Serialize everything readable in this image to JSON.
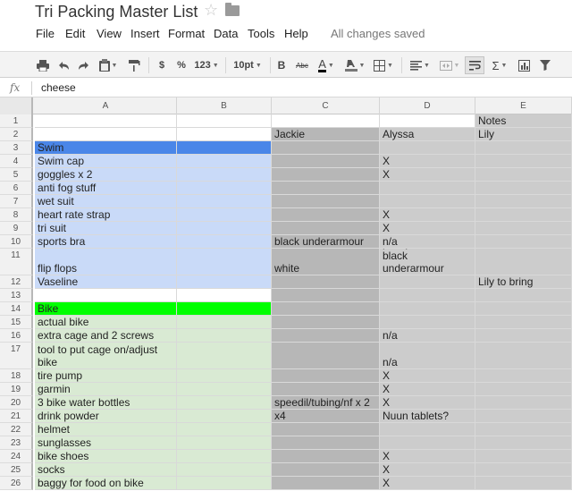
{
  "doc": {
    "title": "Tri Packing Master List",
    "star_glyph": "☆"
  },
  "menu": {
    "items": [
      "File",
      "Edit",
      "View",
      "Insert",
      "Format",
      "Data",
      "Tools",
      "Help"
    ],
    "status": "All changes saved"
  },
  "toolbar": {
    "currency": "$",
    "percent": "%",
    "number_format": "123",
    "font_size": "10pt",
    "bold": "B",
    "strike": "Abc",
    "text_color": "A",
    "sum": "Σ"
  },
  "formula_bar": {
    "label": "fx",
    "value": "cheese"
  },
  "columns": [
    "A",
    "B",
    "C",
    "D",
    "E"
  ],
  "colors": {
    "swim_header": "#4a86e8",
    "swim_row": "#c9daf8",
    "bike_header": "#00ff00",
    "bike_row": "#d9ead3",
    "gray_col": "#b7b7b7",
    "gray_light": "#cccccc"
  },
  "rows": [
    {
      "n": "1",
      "a": "",
      "b": "",
      "c": "",
      "d": "",
      "e": "Notes"
    },
    {
      "n": "2",
      "a": "",
      "b": "",
      "c": "Jackie",
      "d": "Alyssa",
      "e": "Lily"
    },
    {
      "n": "3",
      "a": "Swim",
      "b": "",
      "c": "",
      "d": "",
      "e": ""
    },
    {
      "n": "4",
      "a": "Swim cap",
      "b": "",
      "c": "",
      "d": "X",
      "e": ""
    },
    {
      "n": "5",
      "a": "goggles x 2",
      "b": "",
      "c": "",
      "d": "X",
      "e": ""
    },
    {
      "n": "6",
      "a": "anti fog stuff",
      "b": "",
      "c": "",
      "d": "",
      "e": ""
    },
    {
      "n": "7",
      "a": "wet suit",
      "b": "",
      "c": "",
      "d": "",
      "e": ""
    },
    {
      "n": "8",
      "a": "heart rate strap",
      "b": "",
      "c": "",
      "d": "X",
      "e": ""
    },
    {
      "n": "9",
      "a": "tri suit",
      "b": "",
      "c": "",
      "d": "X",
      "e": ""
    },
    {
      "n": "10",
      "a": "sports bra",
      "b": "",
      "c": "black underarmour",
      "d": "n/a",
      "e": ""
    },
    {
      "n": "11",
      "a": "flip flops",
      "b": "",
      "c": "white",
      "d": "pink plastic and\nblack underarmour",
      "e": ""
    },
    {
      "n": "12",
      "a": "Vaseline",
      "b": "",
      "c": "",
      "d": "",
      "e": "Lily to bring"
    },
    {
      "n": "13",
      "a": "",
      "b": "",
      "c": "",
      "d": "",
      "e": ""
    },
    {
      "n": "14",
      "a": "Bike",
      "b": "",
      "c": "",
      "d": "",
      "e": ""
    },
    {
      "n": "15",
      "a": "actual bike",
      "b": "",
      "c": "",
      "d": "",
      "e": ""
    },
    {
      "n": "16",
      "a": "extra cage and 2 screws",
      "b": "",
      "c": "",
      "d": "n/a",
      "e": ""
    },
    {
      "n": "17",
      "a": "tool to put cage on/adjust\nbike",
      "b": "",
      "c": "",
      "d": "n/a",
      "e": ""
    },
    {
      "n": "18",
      "a": "tire pump",
      "b": "",
      "c": "",
      "d": "X",
      "e": ""
    },
    {
      "n": "19",
      "a": "garmin",
      "b": "",
      "c": "",
      "d": "X",
      "e": ""
    },
    {
      "n": "20",
      "a": "3 bike water bottles",
      "b": "",
      "c": "speedil/tubing/nf x 2",
      "d": "X",
      "e": ""
    },
    {
      "n": "21",
      "a": "drink powder",
      "b": "",
      "c": "x4",
      "d": "Nuun tablets?",
      "e": ""
    },
    {
      "n": "22",
      "a": "helmet",
      "b": "",
      "c": "",
      "d": "",
      "e": ""
    },
    {
      "n": "23",
      "a": "sunglasses",
      "b": "",
      "c": "",
      "d": "",
      "e": ""
    },
    {
      "n": "24",
      "a": "bike shoes",
      "b": "",
      "c": "",
      "d": "X",
      "e": ""
    },
    {
      "n": "25",
      "a": "socks",
      "b": "",
      "c": "",
      "d": "X",
      "e": ""
    },
    {
      "n": "26",
      "a": "baggy for food on bike",
      "b": "",
      "c": "",
      "d": "X",
      "e": ""
    }
  ]
}
